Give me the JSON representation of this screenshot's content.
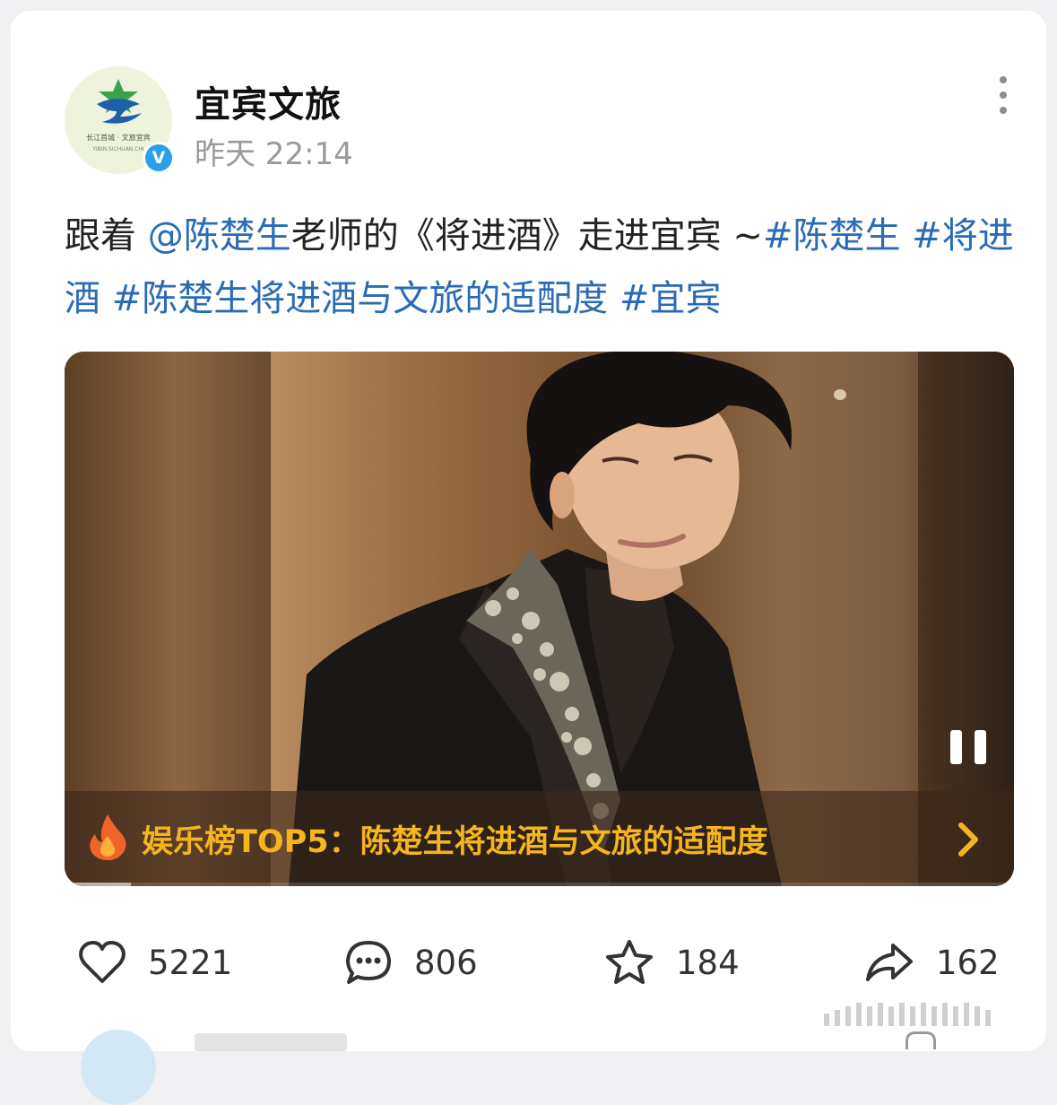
{
  "post": {
    "author": {
      "name": "宜宾文旅",
      "avatar_text": "长江首城 · 文旅宜宾",
      "avatar_subtext": "YIBIN.SICHUAN.CHI",
      "verified_mark": "V"
    },
    "timestamp": "昨天 22:14",
    "text": {
      "prefix": "跟着 ",
      "mention": "@陈楚生",
      "middle": "老师的《将进酒》走进宜宾 ~",
      "tag1": "#陈楚生",
      "tag2": " #将进酒",
      "tag3": " #陈楚生将进酒与文旅的适配度",
      "tag4": " #宜宾"
    },
    "video": {
      "rank_label": "娱乐榜TOP5：陈楚生将进酒与文旅的适配度",
      "progress": 0.07,
      "state": "playing"
    },
    "actions": {
      "likes": "5221",
      "comments": "806",
      "favorites": "184",
      "shares": "162"
    }
  },
  "colors": {
    "link": "#2a6bb5",
    "rank_label": "#f5b51e",
    "verified": "#2aa0e8",
    "timestamp": "#9a9a9a"
  },
  "icons": [
    "more-icon",
    "verified-icon",
    "pause-icon",
    "flame-icon",
    "chevron-right-icon",
    "heart-icon",
    "comment-icon",
    "star-icon",
    "share-icon"
  ]
}
